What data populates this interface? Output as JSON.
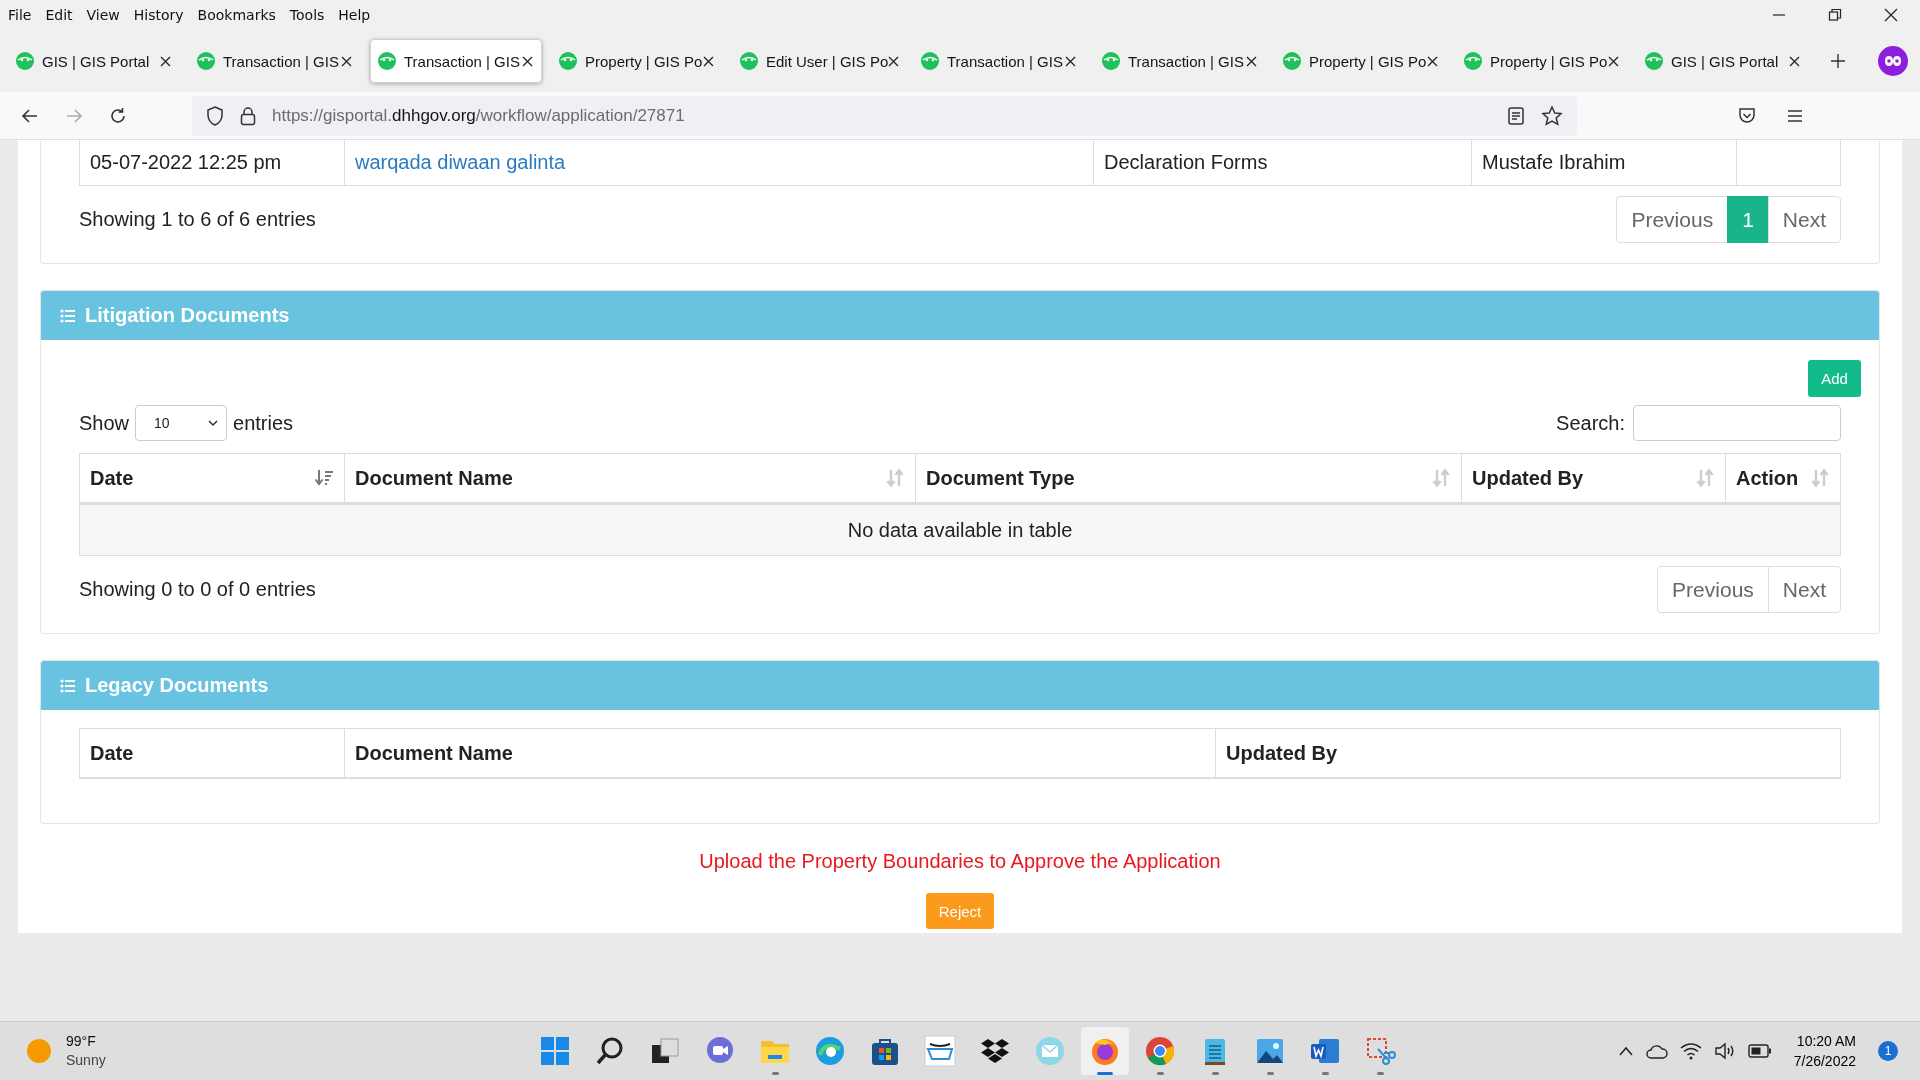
{
  "menu": [
    "File",
    "Edit",
    "View",
    "History",
    "Bookmarks",
    "Tools",
    "Help"
  ],
  "tabs": [
    {
      "title": "GIS | GIS Portal",
      "selected": false
    },
    {
      "title": "Transaction | GIS",
      "selected": false
    },
    {
      "title": "Transaction | GIS",
      "selected": true
    },
    {
      "title": "Property | GIS Po",
      "selected": false
    },
    {
      "title": "Edit User | GIS Po",
      "selected": false
    },
    {
      "title": "Transaction | GIS",
      "selected": false
    },
    {
      "title": "Transaction | GIS",
      "selected": false
    },
    {
      "title": "Property | GIS Po",
      "selected": false
    },
    {
      "title": "Property | GIS Po",
      "selected": false
    },
    {
      "title": "GIS | GIS Portal",
      "selected": false
    }
  ],
  "address": {
    "prefix": "https://gisportal.",
    "domain": "dhhgov.org",
    "path": "/workflow/application/27871"
  },
  "declaration_table": {
    "rows": [
      {
        "cells": [
          "05-07-2022 12:25 pm",
          "warqada diwaan galinta",
          "Declaration Forms",
          "Mustafe Ibrahim",
          ""
        ]
      }
    ],
    "info": "Showing 1 to 6 of 6 entries",
    "pagination": {
      "previous": "Previous",
      "pages": [
        {
          "label": "1",
          "selected": true
        }
      ],
      "next": "Next"
    }
  },
  "litigation": {
    "title": "Litigation Documents",
    "add_button": "Add",
    "show_label": "Show",
    "page_size": "10",
    "entries_label": "entries",
    "search_label": "Search:",
    "columns": [
      {
        "label": "Date",
        "sorted": true
      },
      {
        "label": "Document Name",
        "sorted": false
      },
      {
        "label": "Document Type",
        "sorted": false
      },
      {
        "label": "Updated By",
        "sorted": false
      },
      {
        "label": "Action",
        "sorted": false
      }
    ],
    "empty": "No data available in table",
    "info": "Showing 0 to 0 of 0 entries",
    "pagination": {
      "previous": "Previous",
      "next": "Next"
    }
  },
  "legacy": {
    "title": "Legacy Documents",
    "columns": [
      "Date",
      "Document Name",
      "Updated By"
    ]
  },
  "notice": "Upload the Property Boundaries to Approve the Application",
  "reject_button": "Reject",
  "taskbar": {
    "weather": {
      "temp": "99°F",
      "condition": "Sunny"
    },
    "apps": [
      {
        "kind": "start",
        "open": false,
        "selected": false
      },
      {
        "kind": "search",
        "open": false,
        "selected": false
      },
      {
        "kind": "taskview",
        "open": false,
        "selected": false
      },
      {
        "kind": "chat",
        "open": false,
        "selected": false
      },
      {
        "kind": "folder",
        "open": true,
        "selected": false
      },
      {
        "kind": "edge",
        "open": false,
        "selected": false
      },
      {
        "kind": "store",
        "open": false,
        "selected": false
      },
      {
        "kind": "cart",
        "open": false,
        "selected": false
      },
      {
        "kind": "dropbox",
        "open": false,
        "selected": false
      },
      {
        "kind": "mail",
        "open": false,
        "selected": false
      },
      {
        "kind": "firefox",
        "open": true,
        "selected": true
      },
      {
        "kind": "chrome",
        "open": true,
        "selected": false
      },
      {
        "kind": "notepad",
        "open": true,
        "selected": false
      },
      {
        "kind": "photos",
        "open": true,
        "selected": false
      },
      {
        "kind": "word",
        "open": true,
        "selected": false
      },
      {
        "kind": "snip",
        "open": true,
        "selected": false
      }
    ],
    "time": "10:20 AM",
    "date": "7/26/2022",
    "notifications": "1"
  }
}
